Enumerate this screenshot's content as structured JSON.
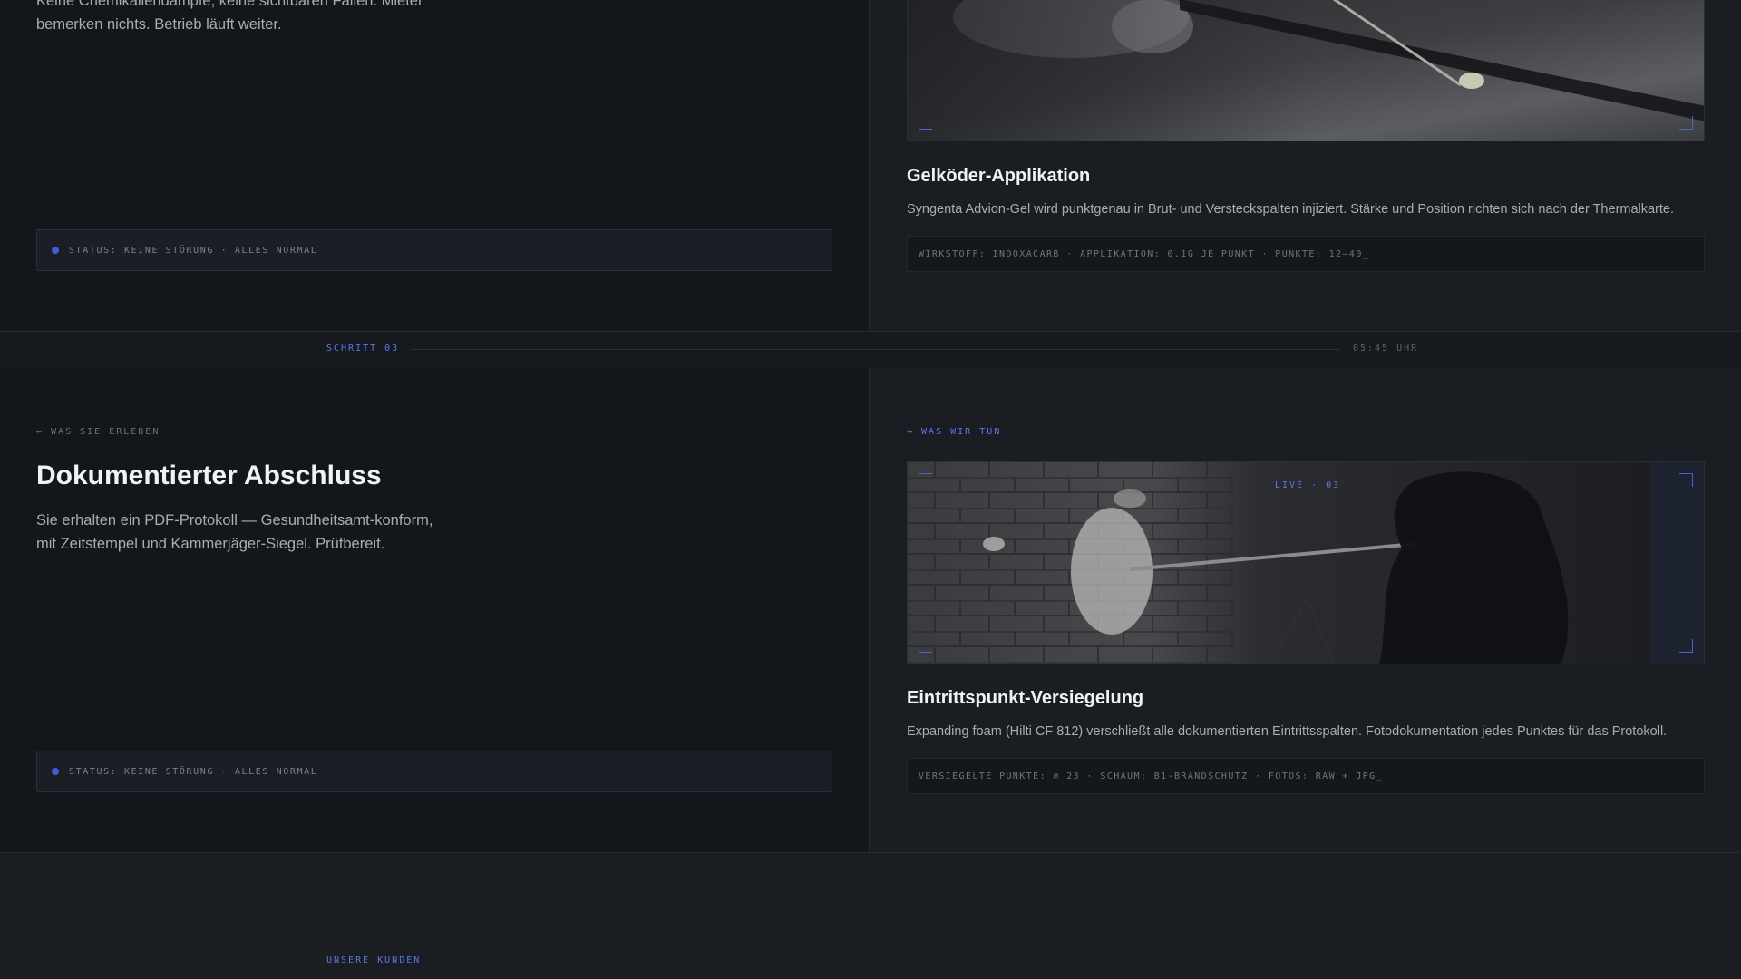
{
  "step2": {
    "intro_line1": "Keine Chemikaliendämpfe, keine sichtbaren Fallen. Mieter",
    "intro_line2": "bemerken nichts. Betrieb läuft weiter.",
    "status": "STATUS: KEINE STÖRUNG · ALLES NORMAL",
    "card_title": "Gelköder-Applikation",
    "card_desc": "Syngenta Advion-Gel wird punktgenau in Brut- und Versteckspalten injiziert. Stärke und Position richten sich nach der Thermalkarte.",
    "card_spec": "WIRKSTOFF: INDOXACARB · APPLIKATION: 0.1G JE PUNKT · PUNKTE: 12–40_"
  },
  "step3": {
    "band_label": "SCHRITT 03",
    "band_time": "05:45 UHR",
    "left_eyebrow": "← WAS SIE ERLEBEN",
    "left_title": "Dokumentierter Abschluss",
    "intro_line1": "Sie erhalten ein PDF-Protokoll — Gesundheitsamt-konform,",
    "intro_line2": "mit Zeitstempel und Kammerjäger-Siegel. Prüfbereit.",
    "status": "STATUS: KEINE STÖRUNG · ALLES NORMAL",
    "right_eyebrow": "→ WAS WIR TUN",
    "live_label": "LIVE · 03",
    "card_title": "Eintrittspunkt-Versiegelung",
    "card_desc": "Expanding foam (Hilti CF 812) verschließt alle dokumentierten Eintrittsspalten. Fotodokumentation jedes Punktes für das Protokoll.",
    "card_spec": "VERSIEGELTE PUNKTE: ∅ 23 · SCHAUM: B1-BRANDSCHUTZ · FOTOS: RAW + JPG_"
  },
  "clients": {
    "label": "UNSERE KUNDEN"
  },
  "colors": {
    "accent": "#4a64c8",
    "status_dot": "#3d5fd6",
    "page_bg": "#14171c"
  }
}
